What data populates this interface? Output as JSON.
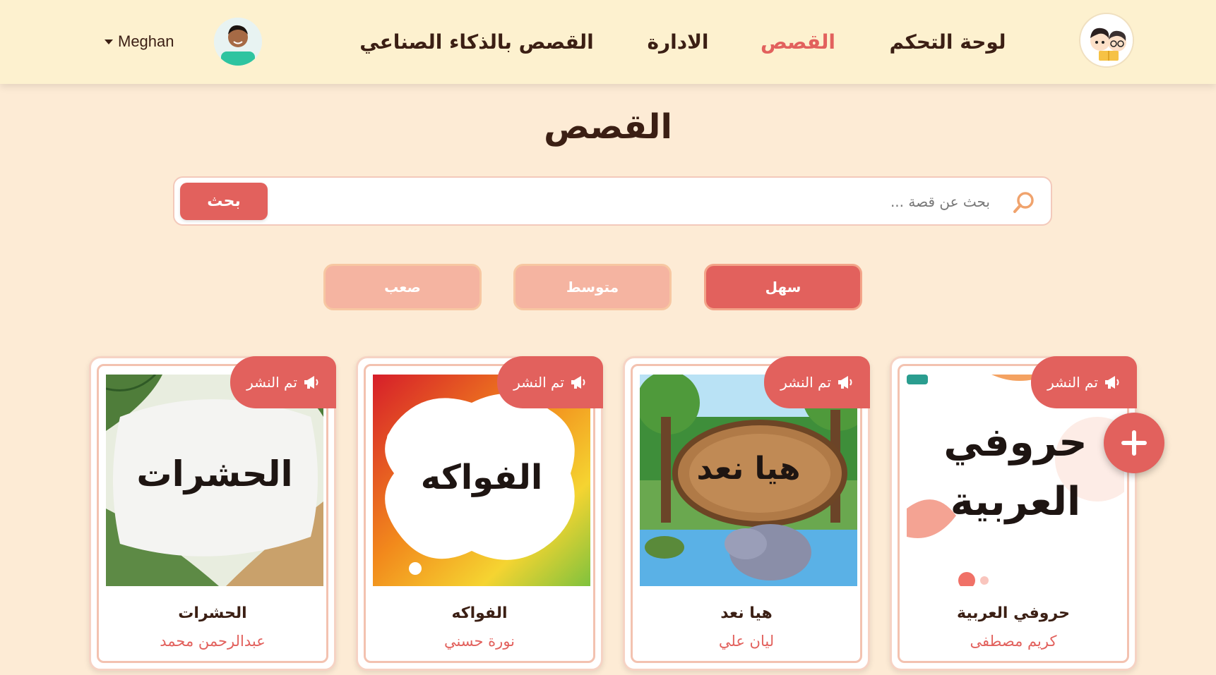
{
  "nav": {
    "links": [
      "لوحة التحكم",
      "القصص",
      "الادارة",
      "القصص بالذكاء الصناعي"
    ],
    "active_index": 1,
    "user_name": "Meghan"
  },
  "page": {
    "title": "القصص"
  },
  "search": {
    "placeholder": "بحث عن قصة ...",
    "button_label": "بحث"
  },
  "filters": {
    "items": [
      "سهل",
      "متوسط",
      "صعب"
    ],
    "active_index": 0
  },
  "stories": [
    {
      "cover_text": "حروفي\nالعربية",
      "title": "حروفي العربية",
      "author": "كريم مصطفى",
      "status": "تم النشر"
    },
    {
      "cover_text": "هيا نعد",
      "title": "هيا نعد",
      "author": "ليان علي",
      "status": "تم النشر"
    },
    {
      "cover_text": "الفواكه",
      "title": "الفواكه",
      "author": "نورة حسني",
      "status": "تم النشر"
    },
    {
      "cover_text": "الحشرات",
      "title": "الحشرات",
      "author": "عبدالرحمن محمد",
      "status": "تم النشر"
    }
  ],
  "icons": {
    "logo": "kids-reading-logo-icon",
    "search": "search-icon",
    "badge": "megaphone-icon",
    "add": "plus-icon",
    "user_menu": "caret-down-icon"
  },
  "colors": {
    "accent": "#e2615d",
    "accent_light": "#f5b4a1",
    "nav_bg": "#fdf1cf",
    "page_bg": "#fdebd5",
    "text_dark": "#3b1f14"
  }
}
